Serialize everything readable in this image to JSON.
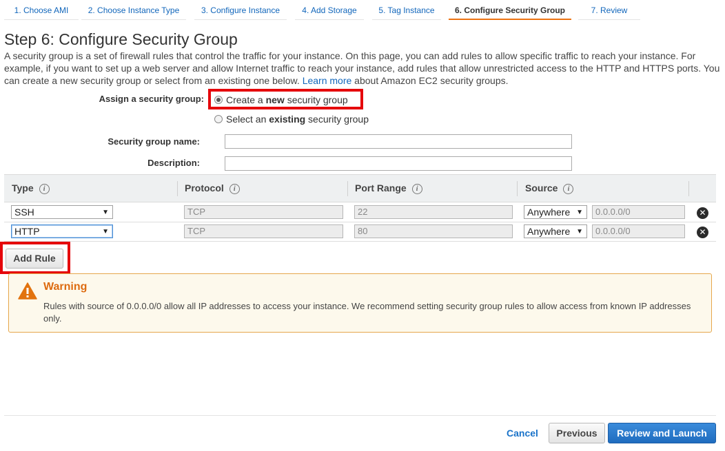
{
  "wizard": {
    "tabs": [
      {
        "label": "1. Choose AMI"
      },
      {
        "label": "2. Choose Instance Type"
      },
      {
        "label": "3. Configure Instance"
      },
      {
        "label": "4. Add Storage"
      },
      {
        "label": "5. Tag Instance"
      },
      {
        "label": "6. Configure Security Group",
        "active": true
      },
      {
        "label": "7. Review"
      }
    ]
  },
  "page": {
    "title": "Step 6: Configure Security Group",
    "intro_text": "A security group is a set of firewall rules that control the traffic for your instance. On this page, you can add rules to allow specific traffic to reach your instance. For example, if you want to set up a web server and allow Internet traffic to reach your instance, add rules that allow unrestricted access to the HTTP and HTTPS ports. You can create a new security group or select from an existing one below.",
    "learn_more_link": "Learn more",
    "intro_suffix": "about Amazon EC2 security groups."
  },
  "assign": {
    "label": "Assign a security group:",
    "option_new": {
      "prefix": "Create a ",
      "bold": "new",
      "suffix": " security group",
      "selected": true
    },
    "option_existing": {
      "prefix": "Select an ",
      "bold": "existing",
      "suffix": " security group",
      "selected": false
    }
  },
  "group_form": {
    "name_label": "Security group name:",
    "name_value": "",
    "description_label": "Description:",
    "description_value": ""
  },
  "rules_table": {
    "headers": [
      "Type",
      "Protocol",
      "Port Range",
      "Source"
    ],
    "rows": [
      {
        "type": "SSH",
        "protocol": "TCP",
        "port_range": "22",
        "source": "Anywhere",
        "cidr": "0.0.0.0/0"
      },
      {
        "type": "HTTP",
        "protocol": "TCP",
        "port_range": "80",
        "source": "Anywhere",
        "cidr": "0.0.0.0/0"
      }
    ]
  },
  "actions": {
    "add_rule": "Add Rule",
    "cancel": "Cancel",
    "previous": "Previous",
    "review_launch": "Review and Launch"
  },
  "warning": {
    "title": "Warning",
    "text": "Rules with source of 0.0.0.0/0 allow all IP addresses to access your instance. We recommend setting security group rules to allow access from known IP addresses only."
  },
  "icons": {
    "info": "info-icon",
    "remove": "remove-rule-icon",
    "warning": "warning-triangle-icon",
    "dropdown": "chevron-down-icon"
  },
  "colors": {
    "link": "#1166bb",
    "active_tab_underline": "#ec7211",
    "highlight_box": "#e5050b",
    "warning_title": "#dd6b10",
    "warning_border": "#e6a64a",
    "primary_button": "#1f6cbf"
  }
}
